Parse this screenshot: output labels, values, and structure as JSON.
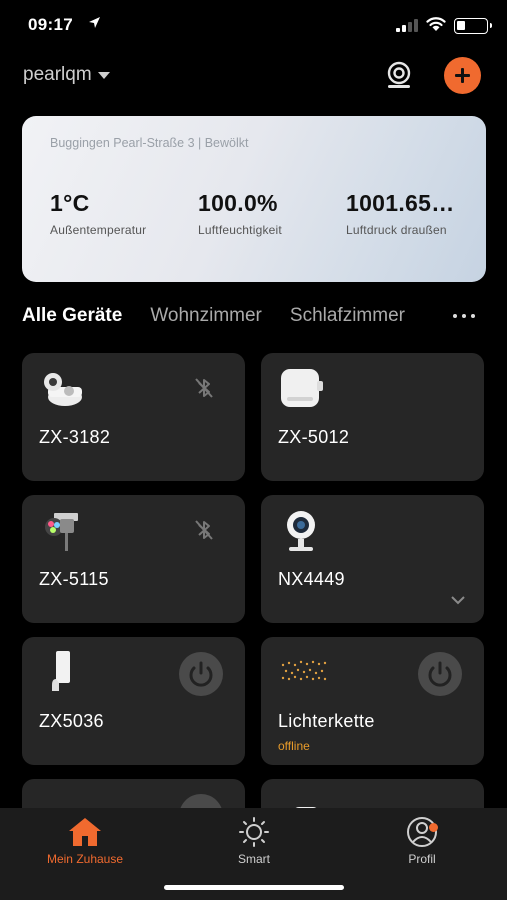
{
  "status_bar": {
    "time": "09:17"
  },
  "header": {
    "home_name": "pearlqm"
  },
  "weather": {
    "location": "Buggingen Pearl-Straße 3 | Bewölkt",
    "stats": [
      {
        "value": "1°C",
        "label": "Außentemperatur"
      },
      {
        "value": "100.0%",
        "label": "Luftfeuchtigkeit"
      },
      {
        "value": "1001.65…",
        "label": "Luftdruck draußen"
      }
    ]
  },
  "tabs": [
    "Alle Geräte",
    "Wohnzimmer",
    "Schlafzimmer"
  ],
  "devices": [
    {
      "name": "ZX-3182",
      "icon": "earbuds-icon",
      "control": "bluetooth-off"
    },
    {
      "name": "ZX-5012",
      "icon": "plug-icon",
      "control": "none"
    },
    {
      "name": "ZX-5115",
      "icon": "spotlight-icon",
      "control": "bluetooth-off"
    },
    {
      "name": "NX4449",
      "icon": "webcam-icon",
      "control": "expand"
    },
    {
      "name": "ZX5036",
      "icon": "hook-sensor-icon",
      "control": "power"
    },
    {
      "name": "Lichterkette",
      "status": "offline",
      "icon": "fairy-lights-icon",
      "control": "power"
    }
  ],
  "bottom_nav": [
    {
      "label": "Mein Zuhause",
      "icon": "home-icon",
      "active": true
    },
    {
      "label": "Smart",
      "icon": "sun-icon",
      "active": false
    },
    {
      "label": "Profil",
      "icon": "profile-icon",
      "active": false
    }
  ],
  "colors": {
    "accent": "#f06a2f",
    "card": "#262626",
    "background": "#000000",
    "offline": "#e89b2a"
  }
}
